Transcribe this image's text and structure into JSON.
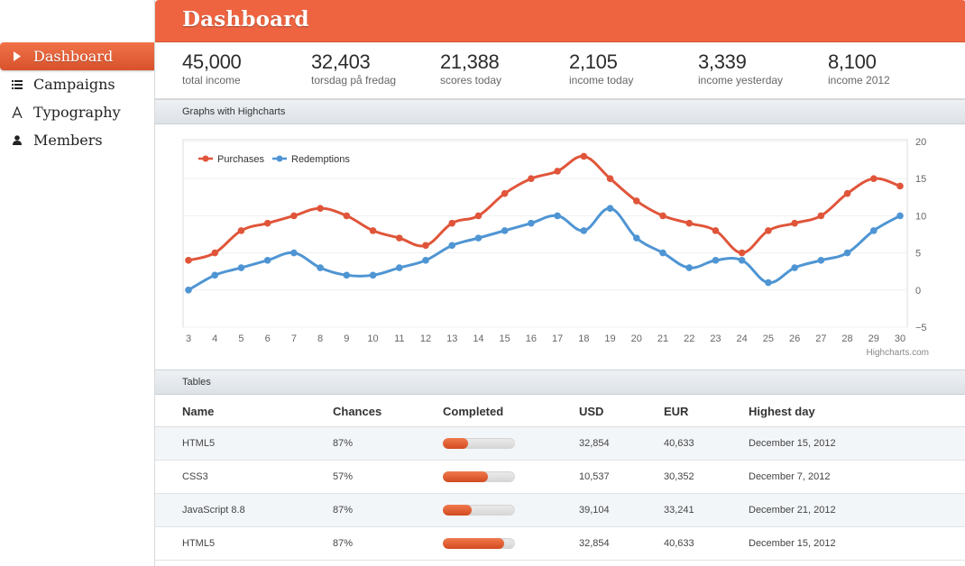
{
  "sidebar": {
    "items": [
      {
        "label": "Dashboard",
        "icon": "play-icon",
        "active": true
      },
      {
        "label": "Campaigns",
        "icon": "list-icon",
        "active": false
      },
      {
        "label": "Typography",
        "icon": "font-icon",
        "active": false
      },
      {
        "label": "Members",
        "icon": "user-icon",
        "active": false
      }
    ]
  },
  "header": {
    "title": "Dashboard"
  },
  "stats": [
    {
      "value": "45,000",
      "caption": "total income"
    },
    {
      "value": "32,403",
      "caption": "torsdag på fredag"
    },
    {
      "value": "21,388",
      "caption": "scores today"
    },
    {
      "value": "2,105",
      "caption": "income today"
    },
    {
      "value": "3,339",
      "caption": "income yesterday"
    },
    {
      "value": "8,100",
      "caption": "income 2012"
    }
  ],
  "sections": {
    "graphs": "Graphs with Highcharts",
    "tables": "Tables"
  },
  "chart_data": {
    "type": "line",
    "x": [
      3,
      4,
      5,
      6,
      7,
      8,
      9,
      10,
      11,
      12,
      13,
      14,
      15,
      16,
      17,
      18,
      19,
      20,
      21,
      22,
      23,
      24,
      25,
      26,
      27,
      28,
      29,
      30
    ],
    "series": [
      {
        "name": "Purchases",
        "color": "#e0553a",
        "values": [
          4,
          5,
          8,
          9,
          10,
          11,
          10,
          8,
          7,
          6,
          9,
          10,
          13,
          15,
          16,
          18,
          15,
          12,
          10,
          9,
          8,
          5,
          8,
          9,
          10,
          13,
          15,
          14
        ]
      },
      {
        "name": "Redemptions",
        "color": "#4f95d3",
        "values": [
          0,
          2,
          3,
          4,
          5,
          3,
          2,
          2,
          3,
          4,
          6,
          7,
          8,
          9,
          10,
          8,
          11,
          7,
          5,
          3,
          4,
          4,
          1,
          3,
          4,
          5,
          8,
          10
        ]
      }
    ],
    "ylim": [
      -5,
      20
    ],
    "yticks": [
      "20",
      "15",
      "10",
      "5",
      "0",
      "−5"
    ],
    "ytick_values": [
      20,
      15,
      10,
      5,
      0,
      -5
    ],
    "credit": "Highcharts.com",
    "legend": "top-left",
    "grid": true
  },
  "table": {
    "headers": [
      "Name",
      "Chances",
      "Completed",
      "USD",
      "EUR",
      "Highest day"
    ],
    "rows": [
      {
        "name": "HTML5",
        "chances": "87%",
        "completed": 0.35,
        "usd": "32,854",
        "eur": "40,633",
        "day": "December 15, 2012"
      },
      {
        "name": "CSS3",
        "chances": "57%",
        "completed": 0.62,
        "usd": "10,537",
        "eur": "30,352",
        "day": "December 7, 2012"
      },
      {
        "name": "JavaScript 8.8",
        "chances": "87%",
        "completed": 0.4,
        "usd": "39,104",
        "eur": "33,241",
        "day": "December 21, 2012"
      },
      {
        "name": "HTML5",
        "chances": "87%",
        "completed": 0.85,
        "usd": "32,854",
        "eur": "40,633",
        "day": "December 15, 2012"
      }
    ]
  }
}
